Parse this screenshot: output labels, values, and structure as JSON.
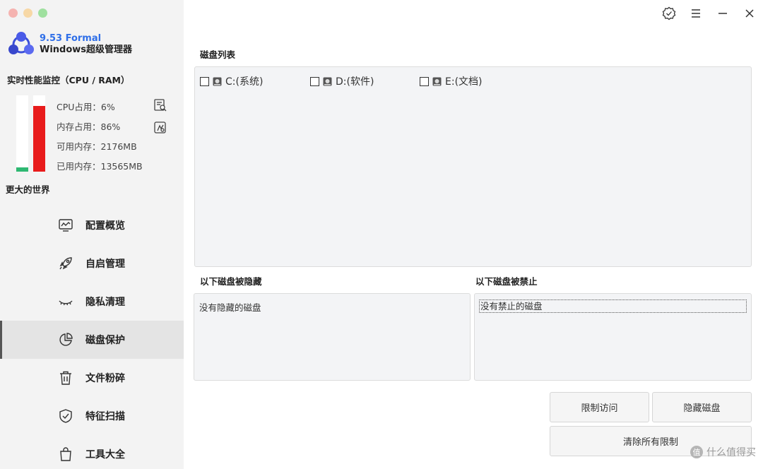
{
  "brand": {
    "version": "9.53 Formal",
    "name": "Windows超级管理器"
  },
  "monitor": {
    "title": "实时性能监控（CPU / RAM）",
    "cpu_percent": 6,
    "ram_percent": 86,
    "cpu_color": "#2eb872",
    "ram_color": "#e81b1b",
    "stats": {
      "cpu": "CPU占用：6%",
      "mem": "内存占用：86%",
      "available": "可用内存：2176MB",
      "used": "已用内存：13565MB"
    },
    "world_label": "更大的世界"
  },
  "nav": {
    "items": [
      {
        "label": "配置概览",
        "icon": "monitor-chart-icon"
      },
      {
        "label": "自启管理",
        "icon": "rocket-icon"
      },
      {
        "label": "隐私清理",
        "icon": "closed-eye-icon"
      },
      {
        "label": "磁盘保护",
        "icon": "pie-chart-icon",
        "active": true
      },
      {
        "label": "文件粉碎",
        "icon": "trash-icon"
      },
      {
        "label": "特征扫描",
        "icon": "shield-check-icon"
      },
      {
        "label": "工具大全",
        "icon": "bag-icon"
      }
    ]
  },
  "main": {
    "disk_list_title": "磁盘列表",
    "disks": [
      {
        "label": "C:(系统)",
        "checked": false
      },
      {
        "label": "D:(软件)",
        "checked": false
      },
      {
        "label": "E:(文档)",
        "checked": false
      }
    ],
    "hidden_title": "以下磁盘被隐藏",
    "hidden_empty": "没有隐藏的磁盘",
    "blocked_title": "以下磁盘被禁止",
    "blocked_empty": "没有禁止的磁盘",
    "buttons": {
      "restrict": "限制访问",
      "hide": "隐藏磁盘",
      "clear": "清除所有限制"
    }
  },
  "watermark": "什么值得买"
}
